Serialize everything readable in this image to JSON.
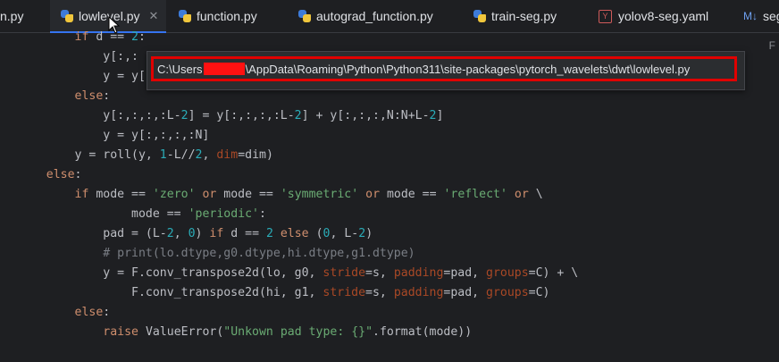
{
  "tabs": [
    {
      "label": "n.py",
      "icon": "none"
    },
    {
      "label": "lowlevel.py",
      "icon": "python-file-icon",
      "active": true
    },
    {
      "label": "function.py",
      "icon": "python-file-icon"
    },
    {
      "label": "autograd_function.py",
      "icon": "python-file-icon"
    },
    {
      "label": "train-seg.py",
      "icon": "python-file-icon"
    },
    {
      "label": "yolov8-seg.yaml",
      "icon": "yaml-file-icon"
    },
    {
      "label": "seg",
      "icon": "markdown-file-icon"
    }
  ],
  "icons": {
    "yaml": "Y",
    "markdown": "M↓",
    "close": "✕"
  },
  "side_letter": "F",
  "tooltip": {
    "path_prefix": "C:\\Users",
    "path_suffix": "\\AppData\\Roaming\\Python\\Python311\\site-packages\\pytorch_wavelets\\dwt\\lowlevel.py"
  },
  "code_lines": [
    "        if d == 2:",
    "            y[:,:",
    "            y = y[",
    "        else:",
    "            y[:,:,:,:L-2] = y[:,:,:,:L-2] + y[:,:,:,N:N+L-2]",
    "            y = y[:,:,:,:N]",
    "        y = roll(y, 1-L//2, dim=dim)",
    "    else:",
    "        if mode == 'zero' or mode == 'symmetric' or mode == 'reflect' or \\",
    "                mode == 'periodic':",
    "            pad = (L-2, 0) if d == 2 else (0, L-2)",
    "            # print(lo.dtype,g0.dtype,hi.dtype,g1.dtype)",
    "            y = F.conv_transpose2d(lo, g0, stride=s, padding=pad, groups=C) + \\",
    "                F.conv_transpose2d(hi, g1, stride=s, padding=pad, groups=C)",
    "        else:",
    "            raise ValueError(\"Unkown pad type: {}\".format(mode))"
  ],
  "colors": {
    "background": "#1e1f22",
    "keyword": "#cf8e6d",
    "number": "#2aacb8",
    "string": "#6aab73",
    "named_param": "#aa4926",
    "comment": "#7a7e85",
    "highlight_box": "#e00000",
    "active_tab_underline": "#3574f0"
  }
}
